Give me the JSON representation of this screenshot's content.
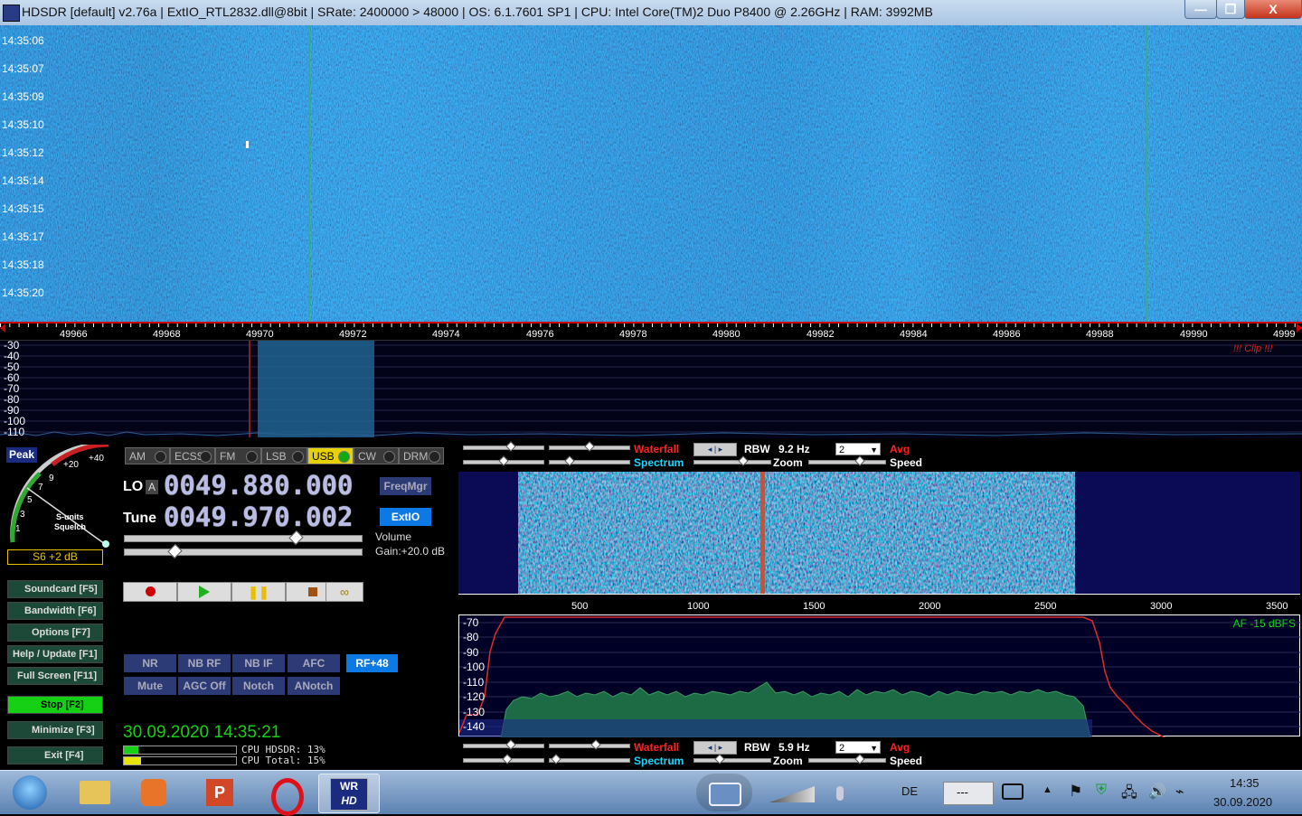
{
  "titlebar": {
    "title": "HDSDR  [default]  v2.76a  |  ExtIO_RTL2832.dll@8bit  |  SRate: 2400000 > 48000  |  OS: 6.1.7601 SP1  |  CPU: Intel Core(TM)2 Duo      P8400  @ 2.26GHz  |  RAM: 3992MB",
    "minimize": "—",
    "restore": "❐",
    "close": "X"
  },
  "waterfall": {
    "timestamps": [
      "14:35:06",
      "14:35:07",
      "14:35:09",
      "14:35:10",
      "14:35:12",
      "14:35:14",
      "14:35:15",
      "14:35:17",
      "14:35:18",
      "14:35:20"
    ]
  },
  "freq_axis": {
    "ticks": [
      "49966",
      "49968",
      "49970",
      "49972",
      "49974",
      "49976",
      "49978",
      "49980",
      "49982",
      "49984",
      "49986",
      "49988",
      "49990",
      "4999"
    ]
  },
  "spectrum": {
    "db_labels": [
      "-30",
      "-40",
      "-50",
      "-60",
      "-70",
      "-80",
      "-90",
      "-100",
      "-110"
    ],
    "clip": "!!! Clip !!!"
  },
  "smeter": {
    "peak": "Peak",
    "scale": [
      "9",
      "+20",
      "+40",
      "7",
      "5",
      "3",
      "1"
    ],
    "label1": "S-units",
    "label2": "Squelch",
    "reading": "S6 +2 dB"
  },
  "modes": [
    "AM",
    "ECSS",
    "FM",
    "LSB",
    "USB",
    "CW",
    "DRM"
  ],
  "active_mode": "USB",
  "freq": {
    "lo_label": "LO",
    "lo_a": "A",
    "lo_value": "0049.880.000",
    "tune_label": "Tune",
    "tune_value": "0049.970.002",
    "freqmgr": "FreqMgr",
    "extio": "ExtIO",
    "volume": "Volume",
    "gain": "Gain:+20.0 dB"
  },
  "sidebuttons": [
    {
      "label": "Soundcard  [F5]"
    },
    {
      "label": "Bandwidth  [F6]"
    },
    {
      "label": "Options  [F7]"
    },
    {
      "label": "Help / Update  [F1]"
    },
    {
      "label": "Full Screen  [F11]"
    },
    {
      "label": "Stop        [F2]"
    },
    {
      "label": "Minimize  [F3]"
    },
    {
      "label": "Exit      [F4]"
    }
  ],
  "dsp": {
    "row1": [
      "NR",
      "NB RF",
      "NB IF",
      "AFC",
      "RF+48"
    ],
    "row2": [
      "Mute",
      "AGC Off",
      "Notch",
      "ANotch"
    ]
  },
  "status": {
    "datetime": "30.09.2020 14:35:21",
    "cpu_hdsdr": "CPU HDSDR: 13%",
    "cpu_total": "CPU Total: 15%",
    "cpu_hdsdr_level": 0.13,
    "cpu_total_level": 0.15
  },
  "rf_ctrl": {
    "waterfall": "Waterfall",
    "spectrum": "Spectrum",
    "rbw_label": "RBW",
    "rbw_value": "9.2 Hz",
    "zoom": "Zoom",
    "select": "2",
    "avg": "Avg",
    "speed": "Speed"
  },
  "af_axis": {
    "ticks": [
      "500",
      "1000",
      "1500",
      "2000",
      "2500",
      "3000",
      "3500"
    ]
  },
  "af_spec": {
    "db_labels": [
      "-70",
      "-80",
      "-90",
      "-100",
      "-110",
      "-120",
      "-130",
      "-140"
    ],
    "level": "AF -15 dBFS"
  },
  "af_ctrl": {
    "waterfall": "Waterfall",
    "spectrum": "Spectrum",
    "rbw_label": "RBW",
    "rbw_value": "5.9 Hz",
    "zoom": "Zoom",
    "select": "2",
    "avg": "Avg",
    "speed": "Speed"
  },
  "taskbar": {
    "lang": "DE",
    "tray_box": "---",
    "time": "14:35",
    "date": "30.09.2020",
    "hdsdr_icon_text1": "WR",
    "hdsdr_icon_text2": "HD"
  },
  "colors": {
    "waterfall_bg": "#1a2f9c",
    "accent_green": "#15d015",
    "waterfall_red": "#ff1a1a",
    "spectrum_cyan": "#18d8ff"
  }
}
